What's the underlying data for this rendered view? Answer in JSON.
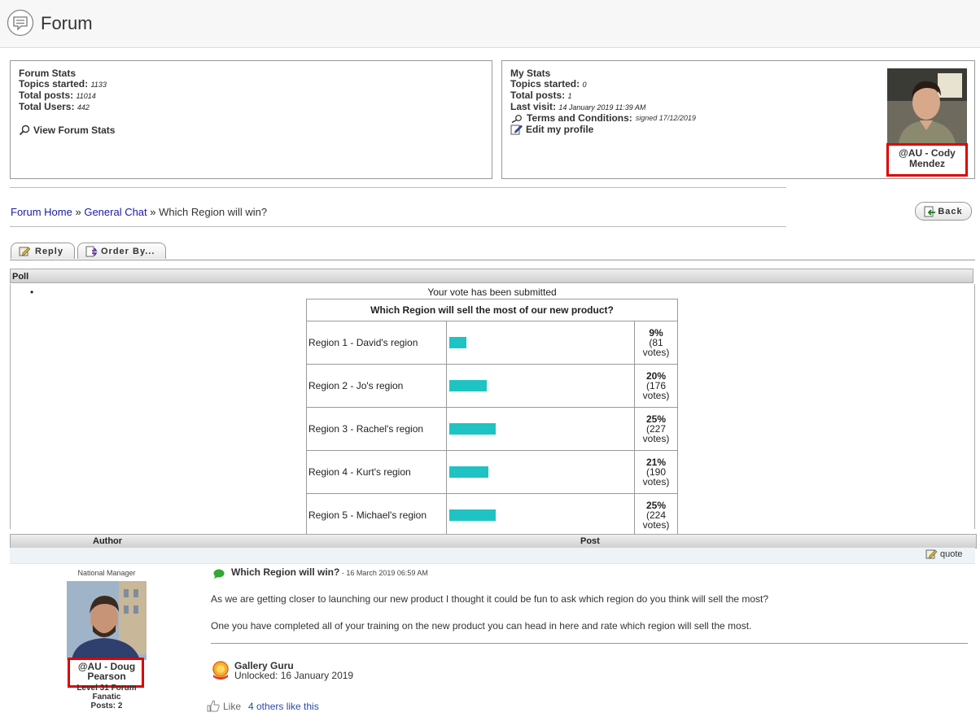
{
  "header": {
    "title": "Forum"
  },
  "forum_stats": {
    "heading": "Forum Stats",
    "topics_label": "Topics started:",
    "topics_value": "1133",
    "posts_label": "Total posts:",
    "posts_value": "11014",
    "users_label": "Total Users:",
    "users_value": "442",
    "view_link": "View Forum Stats"
  },
  "my_stats": {
    "heading": "My Stats",
    "topics_label": "Topics started:",
    "topics_value": "0",
    "posts_label": "Total posts:",
    "posts_value": "1",
    "visit_label": "Last visit:",
    "visit_value": "14 January 2019 11:39 AM",
    "terms_label": "Terms and Conditions:",
    "terms_value": "signed 17/12/2019",
    "edit_link": "Edit my profile",
    "user_name_line1": "@AU - Cody",
    "user_name_line2": "Mendez"
  },
  "breadcrumb": {
    "home": "Forum Home",
    "sep1": " » ",
    "section": "General Chat",
    "sep2": " » ",
    "current": "Which Region will win?"
  },
  "buttons": {
    "back": "Back",
    "reply": "Reply",
    "order_by": "Order By..."
  },
  "poll": {
    "header": "Poll",
    "bullet": "•",
    "status": "Your vote has been submitted",
    "question": "Which Region will sell the most of our new product?",
    "options": [
      {
        "label": "Region 1 - David's region",
        "percent_text": "9%",
        "percent": 9,
        "votes_line1": "(81",
        "votes_line2": "votes)"
      },
      {
        "label": "Region 2 - Jo's region",
        "percent_text": "20%",
        "percent": 20,
        "votes_line1": "(176",
        "votes_line2": "votes)"
      },
      {
        "label": "Region 3 - Rachel's region",
        "percent_text": "25%",
        "percent": 25,
        "votes_line1": "(227",
        "votes_line2": "votes)"
      },
      {
        "label": "Region 4 - Kurt's region",
        "percent_text": "21%",
        "percent": 21,
        "votes_line1": "(190",
        "votes_line2": "votes)"
      },
      {
        "label": "Region 5 - Michael's region",
        "percent_text": "25%",
        "percent": 25,
        "votes_line1": "(224",
        "votes_line2": "votes)"
      }
    ]
  },
  "post_table": {
    "author_col": "Author",
    "post_col": "Post",
    "quote": "quote"
  },
  "post": {
    "author_role": "National Manager",
    "author_name_line1": "@AU - Doug",
    "author_name_line2": "Pearson",
    "author_level_line1": "Level 31 Forum",
    "author_level_line2": "Fanatic",
    "author_posts": "Posts: 2",
    "title": "Which Region will win?",
    "date": " - 16 March 2019 06:59 AM",
    "body_line1": "As we are getting closer to launching our new product I thought it could be fun to ask which region do you think will sell the most?",
    "body_line2": "One you have completed all of your training on the new product you can head in here and rate which region will sell the most.",
    "badge_title": "Gallery Guru",
    "badge_sub": "Unlocked: 16 January 2019",
    "like_label": "Like",
    "like_count": "4 others like this"
  },
  "colors": {
    "accent": "#1fc3c3",
    "link": "#1a1aa6",
    "highlight": "#e00000"
  }
}
